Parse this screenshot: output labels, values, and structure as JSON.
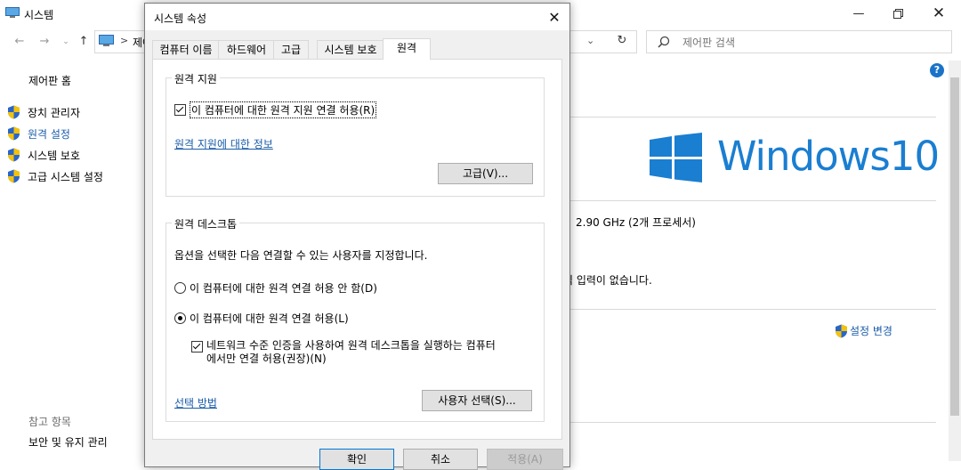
{
  "bg_window": {
    "title": "시스템",
    "address_text": "제어",
    "search_placeholder": "제어판 검색",
    "sidebar": {
      "home": "제어판 홈",
      "items": [
        {
          "label": "장치 관리자"
        },
        {
          "label": "원격 설정"
        },
        {
          "label": "시스템 보호"
        },
        {
          "label": "고급 시스템 설정"
        }
      ],
      "ref_title": "참고 항목",
      "ref_item": "보안 및 유지 관리"
    },
    "logo_text": "Windows10",
    "cpu_info": "2.90 GHz  (2개 프로세서)",
    "touch_info": "식 입력이 없습니다.",
    "settings_change": "설정 변경"
  },
  "dialog": {
    "title": "시스템 속성",
    "tabs": [
      "컴퓨터 이름",
      "하드웨어",
      "고급",
      "시스템 보호",
      "원격"
    ],
    "remote_assist": {
      "group_title": "원격 지원",
      "checkbox_label": "이 컴퓨터에 대한 원격 지원 연결 허용(R)",
      "checkbox_checked": true,
      "info_link": "원격 지원에 대한 정보",
      "advanced_button": "고급(V)..."
    },
    "remote_desktop": {
      "group_title": "원격 데스크톱",
      "description": "옵션을 선택한 다음 연결할 수 있는 사용자를 지정합니다.",
      "radio_disallow": "이 컴퓨터에 대한 원격 연결 허용 안 함(D)",
      "radio_allow": "이 컴퓨터에 대한 원격 연결 허용(L)",
      "selected": "allow",
      "nla_line1": "네트워크 수준 인증을 사용하여 원격 데스크톱을 실행하는 컴퓨터",
      "nla_line2": "에서만 연결 허용(권장)(N)",
      "nla_checked": true,
      "help_link": "선택 방법",
      "select_users_button": "사용자 선택(S)..."
    },
    "buttons": {
      "ok": "확인",
      "cancel": "취소",
      "apply": "적용(A)"
    }
  }
}
